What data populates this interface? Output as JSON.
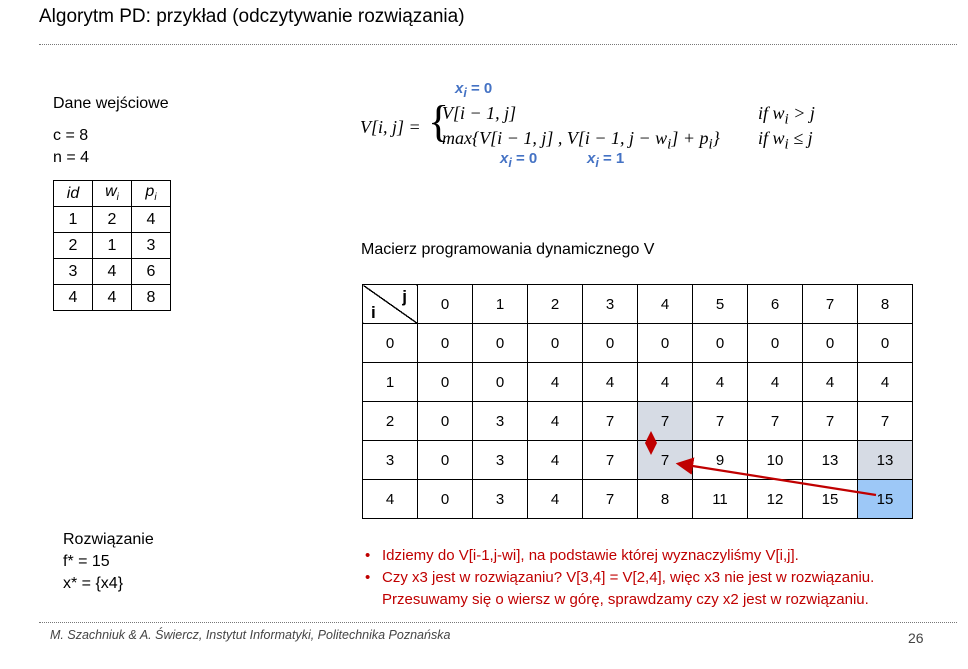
{
  "title": "Algorytm PD: przykład (odczytywanie rozwiązania)",
  "input": {
    "heading": "Dane wejściowe",
    "c_line": "c = 8",
    "n_line": "n = 4",
    "table_headers": [
      "id",
      "w",
      "p"
    ],
    "header_subscript": "i",
    "rows": [
      [
        "1",
        "2",
        "4"
      ],
      [
        "2",
        "1",
        "3"
      ],
      [
        "3",
        "4",
        "6"
      ],
      [
        "4",
        "4",
        "8"
      ]
    ]
  },
  "formula": {
    "lhs": "V[i, j] =",
    "line1": "V[i − 1, j]",
    "line2": "max{V[i − 1, j] , V[i − 1, j − w",
    "line2_end": "] + p",
    "line2_close": "}",
    "cond1": "if   w",
    "cond1_end": " > j",
    "cond2": "if   w",
    "cond2_end": " ≤ j",
    "x_label": "x",
    "x_sub": "i",
    "x_eq0": " = 0",
    "x_eq1": " = 1"
  },
  "matrix": {
    "caption": "Macierz programowania dynamicznego V",
    "corner_j": "j",
    "corner_i": "i",
    "col_headers": [
      "0",
      "1",
      "2",
      "3",
      "4",
      "5",
      "6",
      "7",
      "8"
    ],
    "rows": [
      {
        "i": "0",
        "cells": [
          "0",
          "0",
          "0",
          "0",
          "0",
          "0",
          "0",
          "0",
          "0"
        ]
      },
      {
        "i": "1",
        "cells": [
          "0",
          "0",
          "4",
          "4",
          "4",
          "4",
          "4",
          "4",
          "4"
        ]
      },
      {
        "i": "2",
        "cells": [
          "0",
          "3",
          "4",
          "7",
          "7",
          "7",
          "7",
          "7",
          "7"
        ]
      },
      {
        "i": "3",
        "cells": [
          "0",
          "3",
          "4",
          "7",
          "7",
          "9",
          "10",
          "13",
          "13"
        ]
      },
      {
        "i": "4",
        "cells": [
          "0",
          "3",
          "4",
          "7",
          "8",
          "11",
          "12",
          "15",
          "15"
        ]
      }
    ],
    "colors": {
      "shade": "#d6dbe4",
      "highlight": "#9dc8f7",
      "arrow": "#c00000"
    }
  },
  "solution": {
    "heading": "Rozwiązanie",
    "f_line": "f* = 15",
    "x_line": "x* = {x4}"
  },
  "bullets": [
    "Idziemy do V[i-1,j-wi], na podstawie której wyznaczyliśmy V[i,j].",
    "Czy x3 jest w rozwiązaniu? V[3,4] = V[2,4], więc x3 nie jest w rozwiązaniu. Przesuwamy się o wiersz w górę, sprawdzamy czy x2 jest w rozwiązaniu."
  ],
  "footer": "M. Szachniuk & A. Świercz, Instytut Informatyki, Politechnika Poznańska",
  "page_number": "26"
}
